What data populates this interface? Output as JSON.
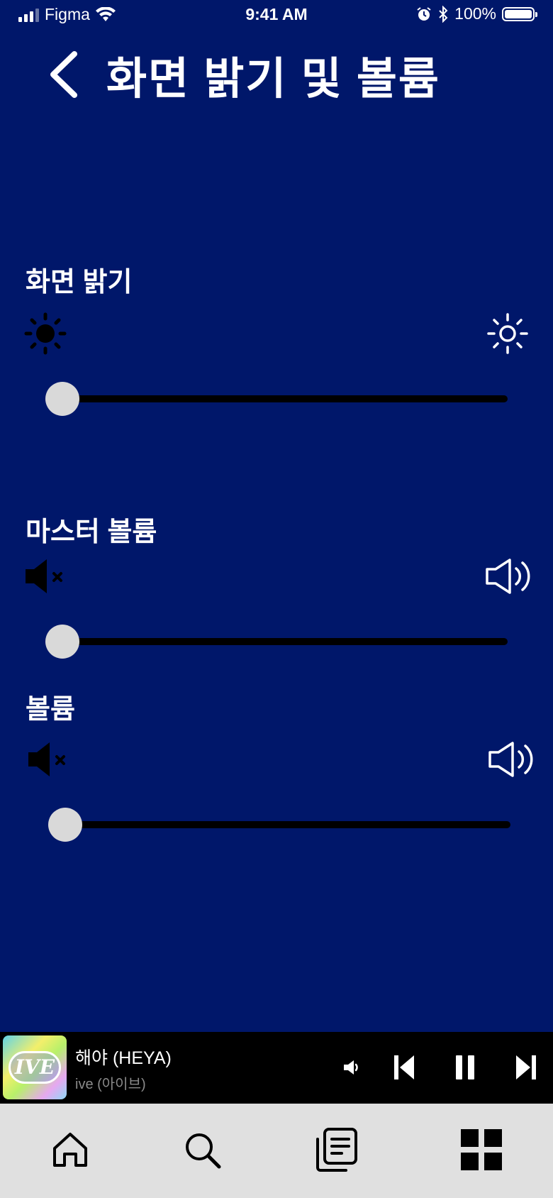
{
  "status_bar": {
    "carrier": "Figma",
    "time": "9:41 AM",
    "battery": "100%"
  },
  "header": {
    "title": "화면 밝기 및 볼륨"
  },
  "brightness": {
    "label": "화면 밝기",
    "value": 0
  },
  "master_volume": {
    "label": "마스터 볼륨",
    "value": 0
  },
  "volume": {
    "label": "볼륨",
    "value": 0
  },
  "mini_player": {
    "title": "해야 (HEYA)",
    "artist": "ive (아이브)",
    "album_art_text": "IVE"
  },
  "tab_bar": {
    "items": [
      "home-icon",
      "search-icon",
      "library-icon",
      "grid-icon"
    ]
  },
  "colors": {
    "background": "#00176a",
    "slider_thumb": "#d9d9d9",
    "slider_track": "#000000",
    "player_bg": "#000000",
    "tab_bar_bg": "#e0e0e0"
  }
}
